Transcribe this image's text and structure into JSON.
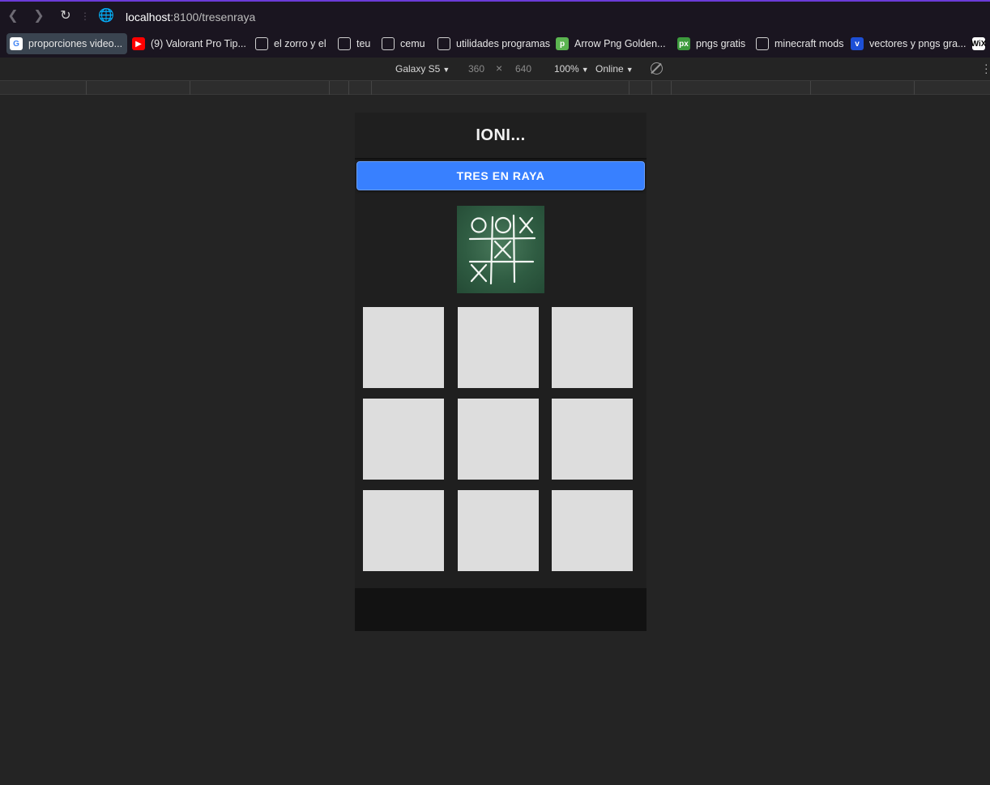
{
  "browser": {
    "url_host": "localhost",
    "url_port_path": ":8100/tresenraya",
    "bookmarks": [
      {
        "label": "proporciones video...",
        "icon": "google-icon"
      },
      {
        "label": "(9) Valorant Pro Tip...",
        "icon": "youtube-icon"
      },
      {
        "label": "el zorro y el",
        "icon": "folder-icon"
      },
      {
        "label": "teu",
        "icon": "folder-icon"
      },
      {
        "label": "cemu",
        "icon": "folder-icon"
      },
      {
        "label": "utilidades programas",
        "icon": "folder-icon"
      },
      {
        "label": "Arrow Png Golden...",
        "icon": "pngtree-icon"
      },
      {
        "label": "pngs gratis",
        "icon": "pixabay-icon"
      },
      {
        "label": "minecraft mods",
        "icon": "folder-icon"
      },
      {
        "label": "vectores y pngs gra...",
        "icon": "vecteezy-icon"
      },
      {
        "label": "",
        "icon": "wix-icon"
      }
    ]
  },
  "devtools": {
    "device": "Galaxy S5",
    "width": "360",
    "times": "×",
    "height": "640",
    "zoom": "100%",
    "network": "Online"
  },
  "app": {
    "title": "IONI...",
    "button_label": "TRES EN RAYA",
    "board_cells": [
      "",
      "",
      "",
      "",
      "",
      "",
      "",
      "",
      ""
    ]
  },
  "colors": {
    "accent": "#3880ff",
    "cell": "#dddddd"
  }
}
